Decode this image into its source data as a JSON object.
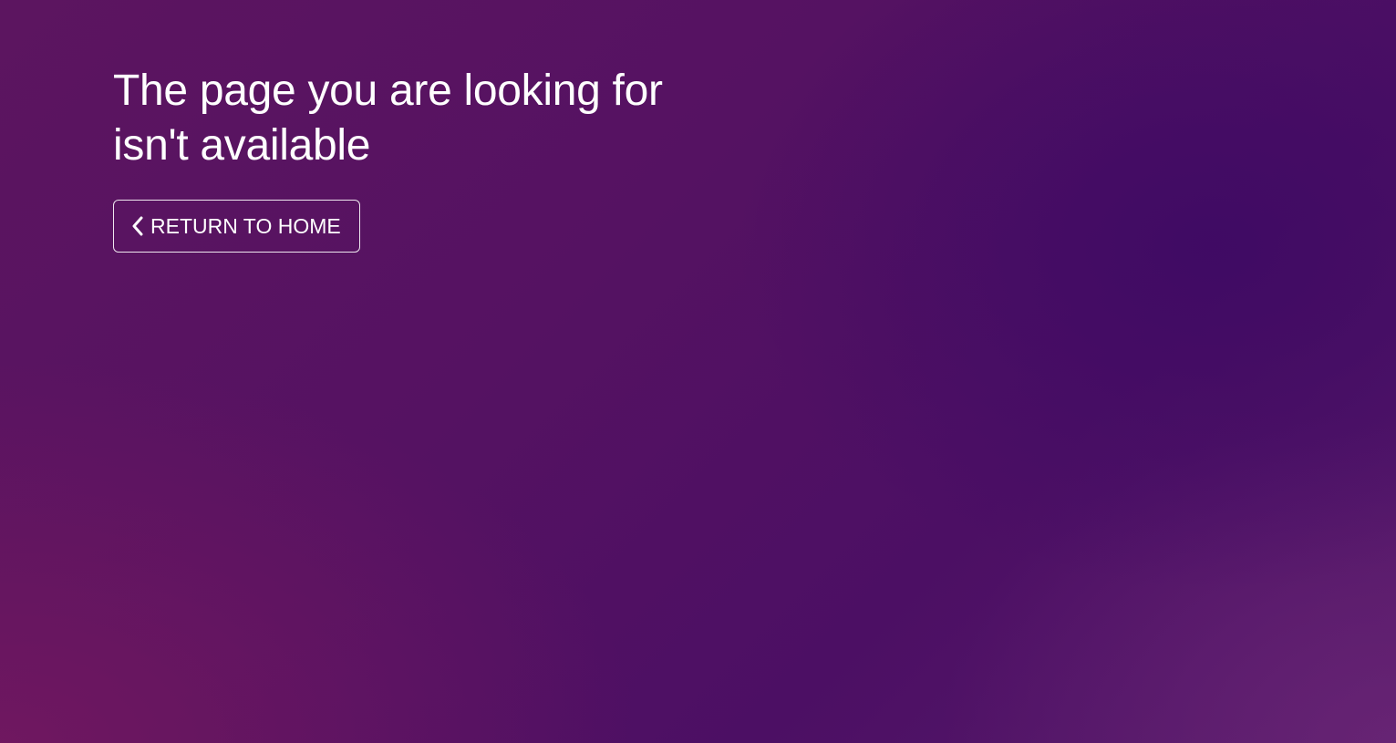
{
  "error": {
    "title_line_1": "The page you are looking for",
    "title_line_2": "isn't available",
    "return_button_label": "RETURN TO HOME",
    "return_icon": "chevron-left-icon"
  },
  "colors": {
    "background_primary": "#551262",
    "background_accent": "#3e0a64",
    "text": "#ffffff"
  }
}
